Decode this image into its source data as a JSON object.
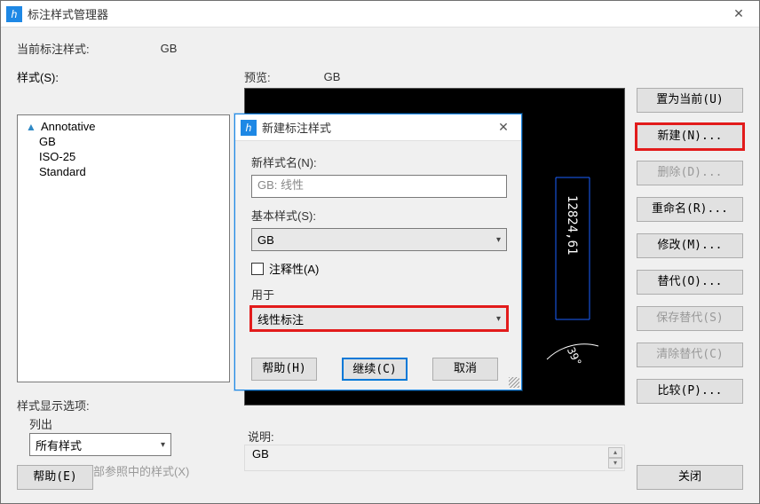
{
  "main": {
    "title": "标注样式管理器",
    "currentStyleLabel": "当前标注样式:",
    "currentStyle": "GB",
    "styleListLabel": "样式(S):",
    "previewLabel": "预览:",
    "previewStyle": "GB",
    "styles": [
      "Annotative",
      "GB",
      "ISO-25",
      "Standard"
    ],
    "displayOptionsLabel": "样式显示选项:",
    "listOutLabel": "列出",
    "listCombo": "所有样式",
    "externalRefChk": "不列出外部参照中的样式(X)",
    "descLabel": "说明:",
    "descValue": "GB"
  },
  "sidebar": {
    "setCurrent": "置为当前(U)",
    "new": "新建(N)...",
    "delete": "删除(D)...",
    "rename": "重命名(R)...",
    "modify": "修改(M)...",
    "override": "替代(O)...",
    "saveOverride": "保存替代(S)",
    "clearOverride": "清除替代(C)",
    "compare": "比较(P)..."
  },
  "buttons": {
    "help": "帮助(E)",
    "close": "关闭"
  },
  "modal": {
    "title": "新建标注样式",
    "newNameLabel": "新样式名(N):",
    "newNameValue": "GB: 线性",
    "baseStyleLabel": "基本样式(S):",
    "baseStyleValue": "GB",
    "annotativeLabel": "注释性(A)",
    "usedForLabel": "用于",
    "usedForValue": "线性标注",
    "helpBtn": "帮助(H)",
    "continueBtn": "继续(C)",
    "cancelBtn": "取消"
  },
  "preview": {
    "dimValue": "12824,61",
    "angleValue": "39°"
  }
}
